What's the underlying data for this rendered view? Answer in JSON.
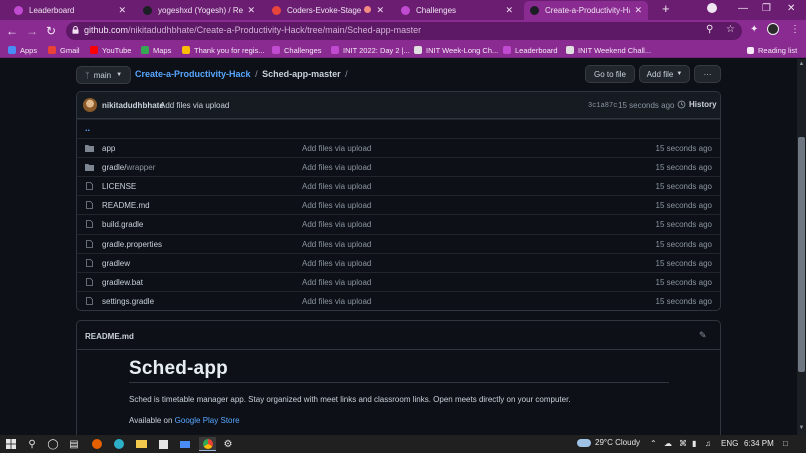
{
  "browser": {
    "tabs": [
      {
        "title": "Leaderboard",
        "favicon_color": "#c04ad0",
        "active": false
      },
      {
        "title": "yogeshxd (Yogesh) / Repositories",
        "favicon_color": "#1b1f24",
        "active": false
      },
      {
        "title": "Coders-Evoke-Stage",
        "favicon_color": "#e8453c",
        "active": false
      },
      {
        "title": "Challenges",
        "favicon_color": "#c04ad0",
        "active": false
      },
      {
        "title": "Create-a-Productivity-Hack/Sched",
        "favicon_color": "#1b1f24",
        "active": true
      }
    ],
    "new_tab": "+",
    "url_host": "github.com",
    "url_path": "/nikitadudhbhate/Create-a-Productivity-Hack/tree/main/Sched-app-master",
    "bookmarks": [
      {
        "label": "Apps",
        "icon_color": "#4a8df6"
      },
      {
        "label": "Gmail",
        "icon_color": "#ea4335"
      },
      {
        "label": "YouTube",
        "icon_color": "#ff0000"
      },
      {
        "label": "Maps",
        "icon_color": "#34a853"
      },
      {
        "label": "Thank you for regis...",
        "icon_color": "#fbbc05"
      },
      {
        "label": "Challenges",
        "icon_color": "#c04ad0"
      },
      {
        "label": "INIT 2022: Day 2 |...",
        "icon_color": "#c04ad0"
      },
      {
        "label": "INIT Week-Long Ch...",
        "icon_color": "#e0e0e0"
      },
      {
        "label": "Leaderboard",
        "icon_color": "#c04ad0"
      },
      {
        "label": "INIT Weekend Chall...",
        "icon_color": "#e0e0e0"
      }
    ],
    "reading_list": "Reading list"
  },
  "repo": {
    "branch": "main",
    "repo_name": "Create-a-Productivity-Hack",
    "dir_name": "Sched-app-master",
    "go_to_file": "Go to file",
    "add_file": "Add file",
    "more": "···",
    "commit": {
      "author": "nikitadudhbhate",
      "message": "Add files via upload",
      "sha": "3c1a87c",
      "time": "15 seconds ago",
      "history": "History"
    },
    "updir": "..",
    "files": [
      {
        "name": "app",
        "dim": "",
        "type": "folder",
        "msg": "Add files via upload",
        "time": "15 seconds ago"
      },
      {
        "name": "gradle/",
        "dim": "wrapper",
        "type": "folder",
        "msg": "Add files via upload",
        "time": "15 seconds ago"
      },
      {
        "name": "LICENSE",
        "dim": "",
        "type": "file",
        "msg": "Add files via upload",
        "time": "15 seconds ago"
      },
      {
        "name": "README.md",
        "dim": "",
        "type": "file",
        "msg": "Add files via upload",
        "time": "15 seconds ago"
      },
      {
        "name": "build.gradle",
        "dim": "",
        "type": "file",
        "msg": "Add files via upload",
        "time": "15 seconds ago"
      },
      {
        "name": "gradle.properties",
        "dim": "",
        "type": "file",
        "msg": "Add files via upload",
        "time": "15 seconds ago"
      },
      {
        "name": "gradlew",
        "dim": "",
        "type": "file",
        "msg": "Add files via upload",
        "time": "15 seconds ago"
      },
      {
        "name": "gradlew.bat",
        "dim": "",
        "type": "file",
        "msg": "Add files via upload",
        "time": "15 seconds ago"
      },
      {
        "name": "settings.gradle",
        "dim": "",
        "type": "file",
        "msg": "Add files via upload",
        "time": "15 seconds ago"
      }
    ]
  },
  "readme": {
    "filename": "README.md",
    "heading": "Sched-app",
    "paragraph": "Sched is timetable manager app. Stay organized with meet links and classroom links. Open meets directly on your computer.",
    "available_prefix": "Available on ",
    "store_link": "Google Play Store"
  },
  "taskbar": {
    "weather_temp": "29°C",
    "weather_desc": "Cloudy",
    "lang": "ENG",
    "time": "6:34 PM"
  }
}
